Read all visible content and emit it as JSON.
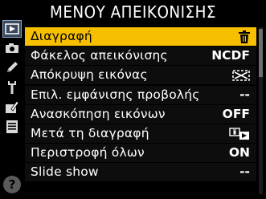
{
  "title": "ΜΕΝΟΥ ΑΠΕΙΚΟΝΙΣΗΣ",
  "sidebar": {
    "tabs": [
      {
        "icon": "playback-icon"
      },
      {
        "icon": "camera-icon"
      },
      {
        "icon": "pencil-icon"
      },
      {
        "icon": "wrench-icon"
      },
      {
        "icon": "retouch-icon"
      },
      {
        "icon": "recent-settings-icon"
      }
    ],
    "help": "?"
  },
  "menu": {
    "items": [
      {
        "label": "Διαγραφή",
        "value": "",
        "icon": "trash-icon",
        "selected": true
      },
      {
        "label": "Φάκελος απεικόνισης",
        "value": "NCDF"
      },
      {
        "label": "Απόκρυψη εικόνας",
        "value": "",
        "icon": "hide-image-icon"
      },
      {
        "label": "Επιλ. εμφάνισης προβολής",
        "value": "--"
      },
      {
        "label": "Ανασκόπηση εικόνων",
        "value": "OFF"
      },
      {
        "label": "Μετά τη διαγραφή",
        "value": "",
        "icon": "after-delete-icon"
      },
      {
        "label": "Περιστροφή όλων",
        "value": "ON"
      },
      {
        "label": "Slide show",
        "value": "--"
      }
    ]
  },
  "colors": {
    "highlight": "#f6c000",
    "background": "#000000",
    "active_tab": "#3a4a5e"
  }
}
